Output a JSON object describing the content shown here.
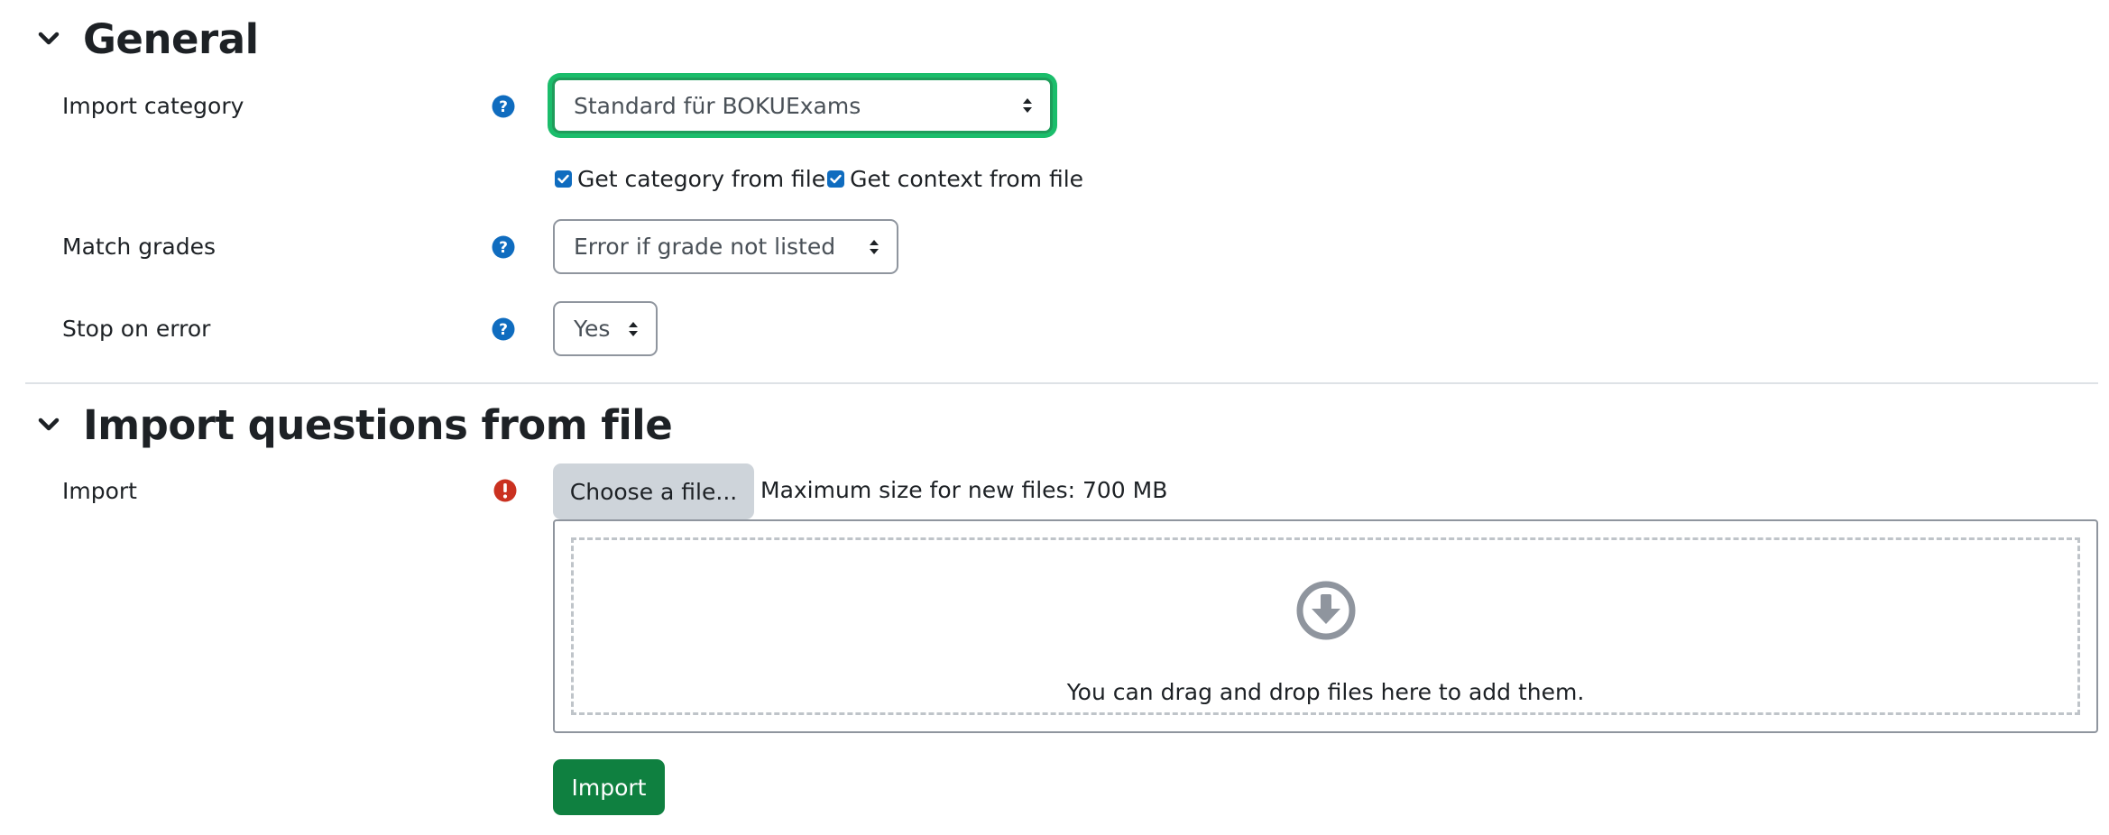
{
  "general": {
    "title": "General",
    "import_category": {
      "label": "Import category",
      "value": "Standard für BOKUExams",
      "help_icon": "help-icon"
    },
    "checkboxes": [
      {
        "label": "Get category from file",
        "checked": true
      },
      {
        "label": "Get context from file",
        "checked": true
      }
    ],
    "match_grades": {
      "label": "Match grades",
      "value": "Error if grade not listed",
      "help_icon": "help-icon"
    },
    "stop_on_error": {
      "label": "Stop on error",
      "value": "Yes",
      "help_icon": "help-icon"
    }
  },
  "import_section": {
    "title": "Import questions from file",
    "import_field": {
      "label": "Import",
      "required_icon": "required-icon",
      "choose_button": "Choose a file...",
      "max_size": "Maximum size for new files: 700 MB",
      "drop_text": "You can drag and drop files here to add them.",
      "drop_icon": "download-arrow-icon"
    },
    "submit_label": "Import"
  },
  "colors": {
    "help": "#0f6cbf",
    "required": "#ca3120",
    "focus_ring": "#1bbd6b",
    "primary_button": "#0f8040",
    "checkbox": "#0f6cbf"
  }
}
